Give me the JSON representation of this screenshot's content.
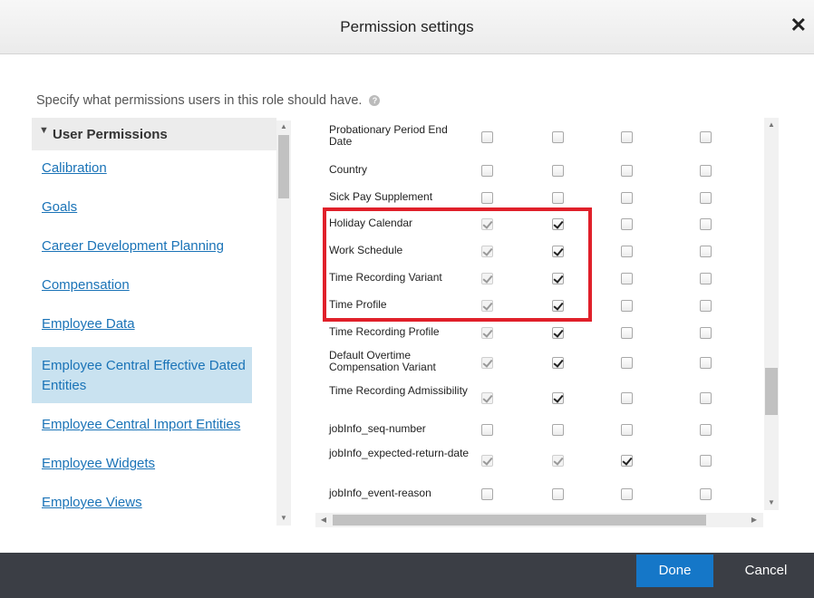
{
  "dialog": {
    "title": "Permission settings",
    "close_glyph": "✕"
  },
  "instructions": "Specify what permissions users in this role should have.",
  "help_glyph": "?",
  "sidebar": {
    "group_label": "User Permissions",
    "group_toggle": "▼",
    "items": [
      {
        "label": "Calibration",
        "selected": false
      },
      {
        "label": "Goals",
        "selected": false
      },
      {
        "label": "Career Development Planning",
        "selected": false
      },
      {
        "label": "Compensation",
        "selected": false
      },
      {
        "label": "Employee Data",
        "selected": false
      },
      {
        "label": "Employee Central Effective Dated Entities",
        "selected": true
      },
      {
        "label": "Employee Central Import Entities",
        "selected": false
      },
      {
        "label": "Employee Widgets",
        "selected": false
      },
      {
        "label": "Employee Views",
        "selected": false
      }
    ]
  },
  "permissions": {
    "rows": [
      {
        "name": "Probationary Period End Date",
        "checks": [
          [
            false,
            false
          ],
          [
            false,
            false
          ],
          [
            false,
            false
          ],
          [
            false,
            false
          ]
        ]
      },
      {
        "name": "Country",
        "checks": [
          [
            false,
            false
          ],
          [
            false,
            false
          ],
          [
            false,
            false
          ],
          [
            false,
            false
          ]
        ]
      },
      {
        "name": "Sick Pay Supplement",
        "checks": [
          [
            false,
            false
          ],
          [
            false,
            false
          ],
          [
            false,
            false
          ],
          [
            false,
            false
          ]
        ]
      },
      {
        "name": "Holiday Calendar",
        "checks": [
          [
            true,
            true
          ],
          [
            true,
            false
          ],
          [
            false,
            false
          ],
          [
            false,
            false
          ]
        ]
      },
      {
        "name": "Work Schedule",
        "checks": [
          [
            true,
            true
          ],
          [
            true,
            false
          ],
          [
            false,
            false
          ],
          [
            false,
            false
          ]
        ]
      },
      {
        "name": "Time Recording Variant",
        "checks": [
          [
            true,
            true
          ],
          [
            true,
            false
          ],
          [
            false,
            false
          ],
          [
            false,
            false
          ]
        ]
      },
      {
        "name": "Time Profile",
        "checks": [
          [
            true,
            true
          ],
          [
            true,
            false
          ],
          [
            false,
            false
          ],
          [
            false,
            false
          ]
        ]
      },
      {
        "name": "Time Recording Profile",
        "checks": [
          [
            true,
            true
          ],
          [
            true,
            false
          ],
          [
            false,
            false
          ],
          [
            false,
            false
          ]
        ]
      },
      {
        "name": "Default Overtime Compensation Variant",
        "checks": [
          [
            true,
            true
          ],
          [
            true,
            false
          ],
          [
            false,
            false
          ],
          [
            false,
            false
          ]
        ]
      },
      {
        "name": "Time Recording Admissibility",
        "checks": [
          [
            true,
            true
          ],
          [
            true,
            false
          ],
          [
            false,
            false
          ],
          [
            false,
            false
          ]
        ]
      },
      {
        "name": "jobInfo_seq-number",
        "checks": [
          [
            false,
            false
          ],
          [
            false,
            false
          ],
          [
            false,
            false
          ],
          [
            false,
            false
          ]
        ]
      },
      {
        "name": "jobInfo_expected-return-date",
        "checks": [
          [
            true,
            true
          ],
          [
            true,
            true
          ],
          [
            true,
            false
          ],
          [
            false,
            false
          ]
        ]
      },
      {
        "name": "jobInfo_event-reason",
        "checks": [
          [
            false,
            false
          ],
          [
            false,
            false
          ],
          [
            false,
            false
          ],
          [
            false,
            false
          ]
        ]
      }
    ]
  },
  "footer": {
    "done_label": "Done",
    "cancel_label": "Cancel"
  },
  "colors": {
    "accent": "#1577c8",
    "highlight": "#e0202a",
    "footer": "#3b3e45",
    "link": "#1a73b7",
    "selected": "#c9e2f0"
  }
}
